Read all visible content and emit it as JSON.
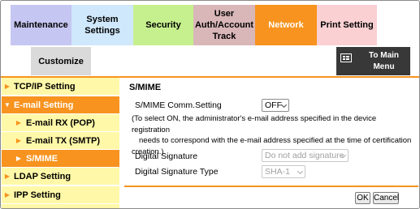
{
  "tabs": {
    "maintenance": "Maintenance",
    "system_settings": "System Settings",
    "security": "Security",
    "user_auth": [
      "User",
      "Auth/Account",
      "Track"
    ],
    "network": "Network",
    "print_setting": "Print Setting",
    "customize": "Customize",
    "to_main_menu": [
      "To Main",
      "Menu"
    ]
  },
  "sidebar": {
    "items": [
      {
        "label": "TCP/IP Setting",
        "level": 1,
        "active": false
      },
      {
        "label": "E-mail Setting",
        "level": 1,
        "active": true,
        "expanded": true
      },
      {
        "label": "E-mail RX (POP)",
        "level": 2,
        "active": false
      },
      {
        "label": "E-mail TX (SMTP)",
        "level": 2,
        "active": false
      },
      {
        "label": "S/MIME",
        "level": 2,
        "active": true
      },
      {
        "label": "LDAP Setting",
        "level": 1,
        "active": false
      },
      {
        "label": "IPP Setting",
        "level": 1,
        "active": false
      }
    ]
  },
  "main": {
    "title": "S/MIME",
    "comm_setting_label": "S/MIME Comm.Setting",
    "comm_setting_value": "OFF",
    "note": [
      "(To select ON, the administrator's e-mail address specified in the device registration",
      "needs to correspond with the e-mail address specified at the time of certification",
      "creation.)"
    ],
    "digital_signature_label": "Digital Signature",
    "digital_signature_value": "Do not add signature",
    "digital_signature_type_label": "Digital Signature Type",
    "digital_signature_type_value": "SHA-1",
    "ok_label": "OK",
    "cancel_label": "Cancel"
  },
  "colors": {
    "accent": "#f7931e",
    "sidebar_bg": "#fff8a8",
    "tab_maintenance": "#c6c6f2",
    "tab_system": "#cfe8fb",
    "tab_security": "#c6f08e",
    "tab_user_auth": "#d9b6b8",
    "tab_print": "#fad0d3",
    "tab_customize": "#dadada",
    "main_menu_bg": "#383838"
  },
  "icons": {
    "main_menu": "main-menu-icon",
    "sidebar_arrow": "triangle-right-icon",
    "sidebar_arrow_expanded": "triangle-down-icon",
    "select": "chevron-down-icon"
  }
}
